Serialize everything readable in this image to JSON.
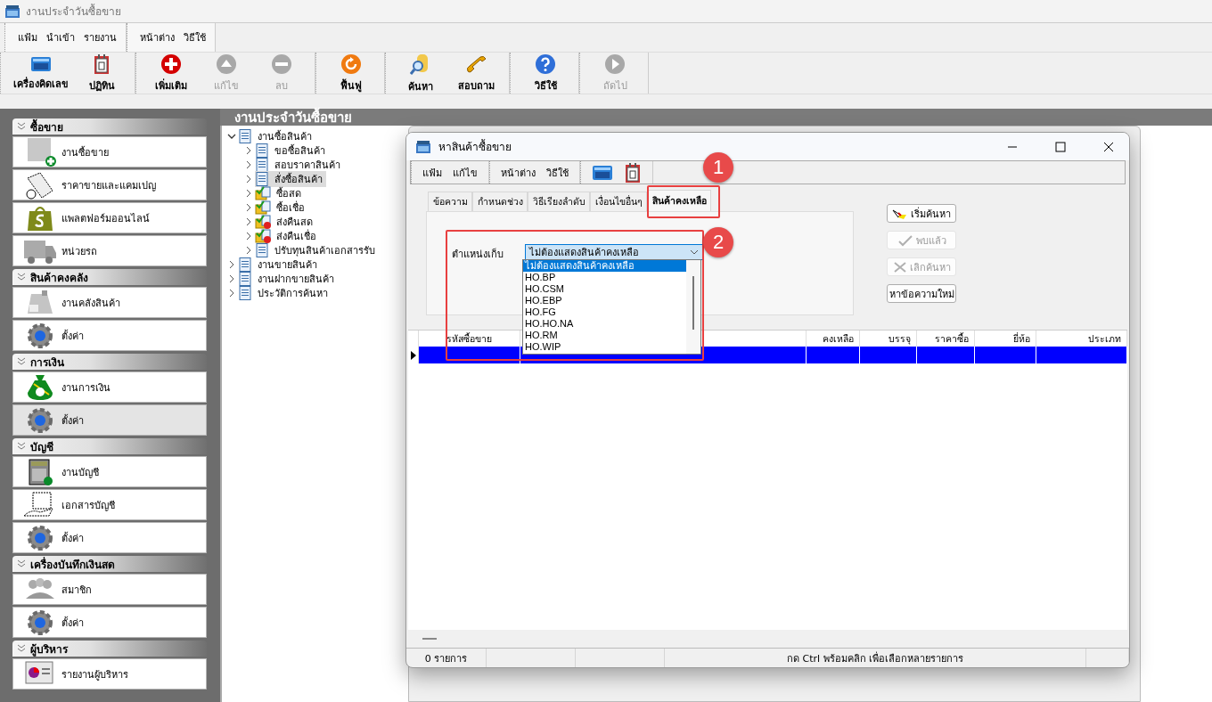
{
  "window": {
    "title": "งานประจำวันซื้อขาย"
  },
  "menu_groups": [
    {
      "items": [
        "แฟ้ม",
        "นำเข้า",
        "รายงาน"
      ]
    },
    {
      "items": [
        "หน้าต่าง",
        "วิธีใช้"
      ]
    }
  ],
  "toolbar_groups": [
    {
      "buttons": [
        {
          "label": "เครื่องคิดเลข",
          "disabled": false
        },
        {
          "label": "ปฏิทิน",
          "disabled": false
        }
      ]
    },
    {
      "buttons": [
        {
          "label": "เพิ่มเติม",
          "disabled": false
        },
        {
          "label": "แก้ไข",
          "disabled": true
        },
        {
          "label": "ลบ",
          "disabled": true
        }
      ]
    },
    {
      "buttons": [
        {
          "label": "ฟื้นฟู",
          "disabled": false
        }
      ]
    },
    {
      "buttons": [
        {
          "label": "ค้นหา",
          "disabled": false
        },
        {
          "label": "สอบถาม",
          "disabled": false
        }
      ]
    },
    {
      "buttons": [
        {
          "label": "วิธีใช้",
          "disabled": false
        }
      ]
    },
    {
      "buttons": [
        {
          "label": "ถัดไป",
          "disabled": true
        }
      ]
    }
  ],
  "sidebar": {
    "groups": [
      {
        "title": "ซื้อขาย",
        "items": [
          {
            "label": "งานซื้อขาย",
            "selected": false
          },
          {
            "label": "ราคาขายและแคมเปญ",
            "selected": false
          },
          {
            "label": "แพลตฟอร์มออนไลน์",
            "selected": false
          },
          {
            "label": "หน่วยรถ",
            "selected": false
          }
        ]
      },
      {
        "title": "สินค้าคงคลัง",
        "items": [
          {
            "label": "งานคลังสินค้า",
            "selected": false
          },
          {
            "label": "ตั้งค่า",
            "selected": false
          }
        ]
      },
      {
        "title": "การเงิน",
        "items": [
          {
            "label": "งานการเงิน",
            "selected": false
          },
          {
            "label": "ตั้งค่า",
            "selected": true
          }
        ]
      },
      {
        "title": "บัญชี",
        "items": [
          {
            "label": "งานบัญชี",
            "selected": false
          },
          {
            "label": "เอกสารบัญชี",
            "selected": false
          },
          {
            "label": "ตั้งค่า",
            "selected": false
          }
        ]
      },
      {
        "title": "เครื่องบันทึกเงินสด",
        "items": [
          {
            "label": "สมาชิก",
            "selected": false
          },
          {
            "label": "ตั้งค่า",
            "selected": false
          }
        ]
      },
      {
        "title": "ผู้บริหาร",
        "items": [
          {
            "label": "รายงานผู้บริหาร",
            "selected": false
          }
        ]
      }
    ]
  },
  "content_header": "งานประจำวันซื้อขาย",
  "tree": [
    {
      "label": "งานซื้อสินค้า",
      "kind": "document",
      "expanded": true,
      "selected": false,
      "children": [
        {
          "label": "ขอซื้อสินค้า",
          "kind": "document",
          "expanded": false,
          "selected": false
        },
        {
          "label": "สอบราคาสินค้า",
          "kind": "document",
          "expanded": false,
          "selected": false
        },
        {
          "label": "สั่งซื้อสินค้า",
          "kind": "document",
          "expanded": false,
          "selected": true
        },
        {
          "label": "ซื้อสด",
          "kind": "folder",
          "expanded": false,
          "selected": false
        },
        {
          "label": "ซื้อเชื่อ",
          "kind": "folder",
          "expanded": false,
          "selected": false
        },
        {
          "label": "ส่งคืนสด",
          "kind": "return",
          "expanded": false,
          "selected": false
        },
        {
          "label": "ส่งคืนเชื่อ",
          "kind": "return",
          "expanded": false,
          "selected": false
        },
        {
          "label": "ปรับทุนสินค้าเอกสารรับ",
          "kind": "document",
          "expanded": false,
          "selected": false
        }
      ]
    },
    {
      "label": "งานขายสินค้า",
      "kind": "document",
      "expanded": false,
      "selected": false
    },
    {
      "label": "งานฝากขายสินค้า",
      "kind": "document",
      "expanded": false,
      "selected": false
    },
    {
      "label": "ประวัติการค้นหา",
      "kind": "document",
      "expanded": false,
      "selected": false
    }
  ],
  "dialog": {
    "title": "หาสินค้าซื้อขาย",
    "menu_groups": [
      {
        "items": [
          "แฟ้ม",
          "แก้ไข"
        ]
      },
      {
        "items": [
          "หน้าต่าง",
          "วิธีใช้"
        ]
      }
    ],
    "tabs": [
      {
        "label": "ข้อความ",
        "selected": false
      },
      {
        "label": "กำหนดช่วง",
        "selected": false
      },
      {
        "label": "วิธีเรียงลำดับ",
        "selected": false
      },
      {
        "label": "เงื่อนไขอื่นๆ",
        "selected": false
      },
      {
        "label": "สินค้าคงเหลือ",
        "selected": true
      }
    ],
    "field": {
      "label": "ตำแหน่งเก็บ",
      "value": "ไม่ต้องแสดงสินค้าคงเหลือ",
      "expanded": true,
      "options": [
        {
          "label": "ไม่ต้องแสดงสินค้าคงเหลือ",
          "selected": true
        },
        {
          "label": "HO.BP",
          "selected": false
        },
        {
          "label": "HO.CSM",
          "selected": false
        },
        {
          "label": "HO.EBP",
          "selected": false
        },
        {
          "label": "HO.FG",
          "selected": false
        },
        {
          "label": "HO.HO.NA",
          "selected": false
        },
        {
          "label": "HO.RM",
          "selected": false
        },
        {
          "label": "HO.WIP",
          "selected": false
        }
      ]
    },
    "buttons": [
      {
        "label": "เริ่มค้นหา",
        "disabled": false
      },
      {
        "label": "พบแล้ว",
        "disabled": true
      },
      {
        "label": "เลิกค้นหา",
        "disabled": true
      },
      {
        "label": "หาข้อความใหม่",
        "disabled": false
      }
    ],
    "columns": [
      {
        "label": "รหัสซื้อขาย"
      },
      {},
      {
        "label": "คงเหลือ"
      },
      {
        "label": "บรรจุ"
      },
      {
        "label": "ราคาซื้อ"
      },
      {
        "label": "ยี่ห้อ"
      },
      {
        "label": "ประเภท"
      }
    ],
    "rows": [
      {
        "selected": true
      }
    ],
    "status_bar": {
      "count": "0 รายการ",
      "hint": "กด Ctrl พร้อมคลิก เพื่อเลือกหลายรายการ"
    }
  },
  "annotations": [
    {
      "label": "1"
    },
    {
      "label": "2"
    }
  ]
}
